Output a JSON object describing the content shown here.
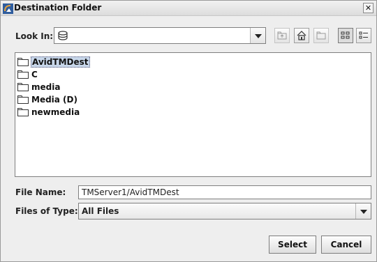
{
  "window": {
    "title": "Destination Folder",
    "close_glyph": "✕"
  },
  "look_in": {
    "label": "Look In:",
    "value": ""
  },
  "toolbar": {
    "up_folder": "up-one-level-icon",
    "home": "home-icon",
    "new_folder": "new-folder-icon",
    "list_view": "list-view-icon",
    "details_view": "details-view-icon"
  },
  "files": [
    {
      "name": "AvidTMDest",
      "selected": true
    },
    {
      "name": "C"
    },
    {
      "name": "media"
    },
    {
      "name": "Media (D)"
    },
    {
      "name": "newmedia"
    }
  ],
  "file_name": {
    "label": "File Name:",
    "value": "TMServer1/AvidTMDest"
  },
  "files_of_type": {
    "label": "Files of Type:",
    "value": "All Files"
  },
  "buttons": {
    "select": "Select",
    "cancel": "Cancel"
  },
  "colors": {
    "selection": "#c8d7ea",
    "background": "#eeeeee"
  }
}
